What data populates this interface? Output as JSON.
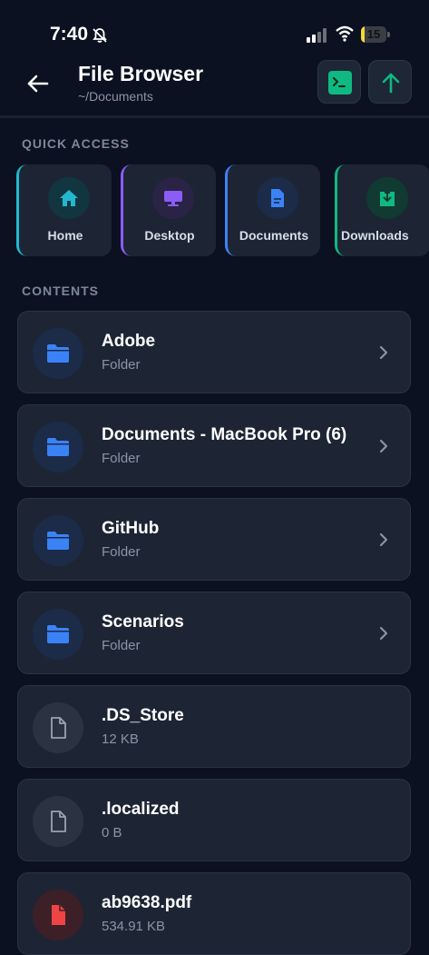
{
  "status": {
    "time": "7:40",
    "battery": "15",
    "battery_level": 0.15
  },
  "header": {
    "title": "File Browser",
    "path": "~/Documents"
  },
  "sections": {
    "quick_access": "QUICK ACCESS",
    "contents": "CONTENTS"
  },
  "quick_access": [
    {
      "label": "Home",
      "icon": "home-icon",
      "accent": "#22b8cf"
    },
    {
      "label": "Desktop",
      "icon": "monitor-icon",
      "accent": "#8b5cf6"
    },
    {
      "label": "Documents",
      "icon": "document-icon",
      "accent": "#3b82f6"
    },
    {
      "label": "Downloads",
      "icon": "download-icon",
      "accent": "#10b981"
    }
  ],
  "contents": [
    {
      "name": "Adobe",
      "meta": "Folder",
      "type": "folder"
    },
    {
      "name": "Documents - MacBook Pro (6)",
      "meta": "Folder",
      "type": "folder"
    },
    {
      "name": "GitHub",
      "meta": "Folder",
      "type": "folder"
    },
    {
      "name": "Scenarios",
      "meta": "Folder",
      "type": "folder"
    },
    {
      "name": ".DS_Store",
      "meta": "12 KB",
      "type": "file"
    },
    {
      "name": ".localized",
      "meta": "0 B",
      "type": "file"
    },
    {
      "name": "ab9638.pdf",
      "meta": "534.91 KB",
      "type": "pdf"
    }
  ],
  "colors": {
    "background": "#0b1120",
    "card": "#1d2534",
    "folder_blue": "#3b82f6",
    "pdf_red": "#ef4444",
    "terminal_green": "#10b981"
  }
}
